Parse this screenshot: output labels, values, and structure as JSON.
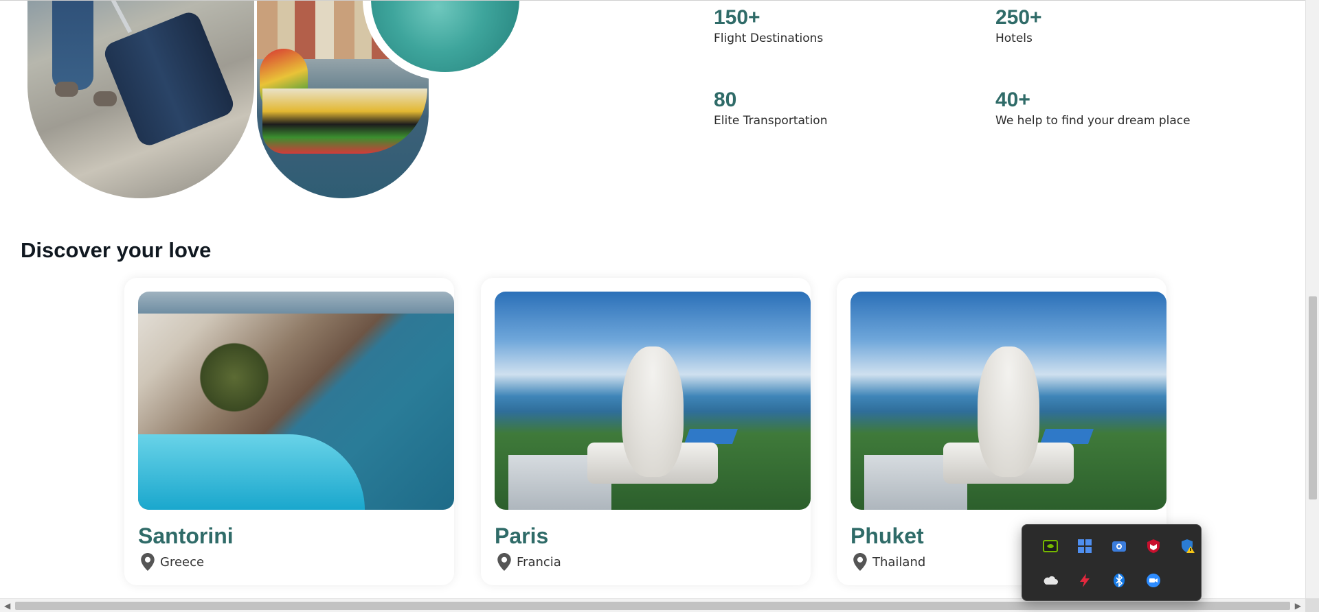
{
  "stats": [
    {
      "value": "150+",
      "label": "Flight Destinations"
    },
    {
      "value": "250+",
      "label": "Hotels"
    },
    {
      "value": "80",
      "label": "Elite Transportation"
    },
    {
      "value": "40+",
      "label": "We help to find your dream place"
    }
  ],
  "discover": {
    "title": "Discover your love",
    "cards": [
      {
        "name": "Santorini",
        "location": "Greece"
      },
      {
        "name": "Paris",
        "location": "Francia"
      },
      {
        "name": "Phuket",
        "location": "Thailand"
      }
    ]
  },
  "tray": {
    "icons": [
      "nvidia-icon",
      "task-manager-icon",
      "screenshot-icon",
      "mcafee-icon",
      "security-warning-icon",
      "onedrive-icon",
      "flash-icon",
      "bluetooth-icon",
      "zoom-icon"
    ]
  },
  "colors": {
    "accent": "#2f6b68",
    "heading": "#101820"
  }
}
